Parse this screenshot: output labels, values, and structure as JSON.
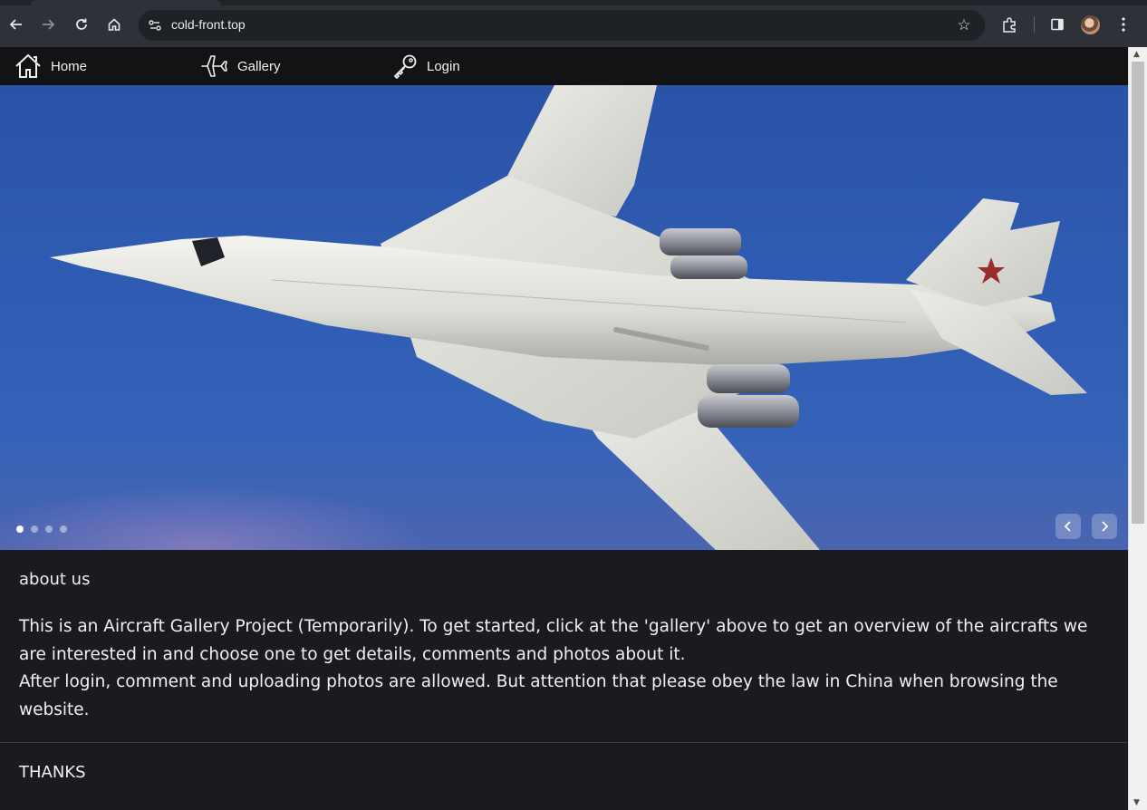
{
  "browser": {
    "url": "cold-front.top",
    "icons": [
      "back-arrow-icon",
      "forward-arrow-icon",
      "reload-icon",
      "home-icon",
      "site-info-icon",
      "bookmark-star-icon",
      "extensions-icon",
      "side-panel-icon",
      "profile-avatar",
      "kebab-menu-icon"
    ]
  },
  "nav": {
    "items": [
      {
        "label": "Home",
        "icon": "house-icon"
      },
      {
        "label": "Gallery",
        "icon": "airplane-icon"
      },
      {
        "label": "Login",
        "icon": "key-icon"
      }
    ]
  },
  "carousel": {
    "slide_count": 4,
    "active_index": 0,
    "image_subject": "white swept-wing jet bomber against blue sky"
  },
  "about": {
    "title": "about us",
    "line1": "This is an Aircraft Gallery Project (Temporarily). To get started, click at the 'gallery' above to get an overview of the aircrafts we are interested in and choose one to get details, comments and photos about it.",
    "line2": "After login, comment and uploading photos are allowed. But attention that please obey the law in China when browsing the website."
  },
  "footer": {
    "thanks": "THANKS"
  },
  "colors": {
    "nav_bg": "#131215",
    "page_bg": "#1b1a1f",
    "sky": "#2f5cb3",
    "text": "#f0f0f0"
  }
}
